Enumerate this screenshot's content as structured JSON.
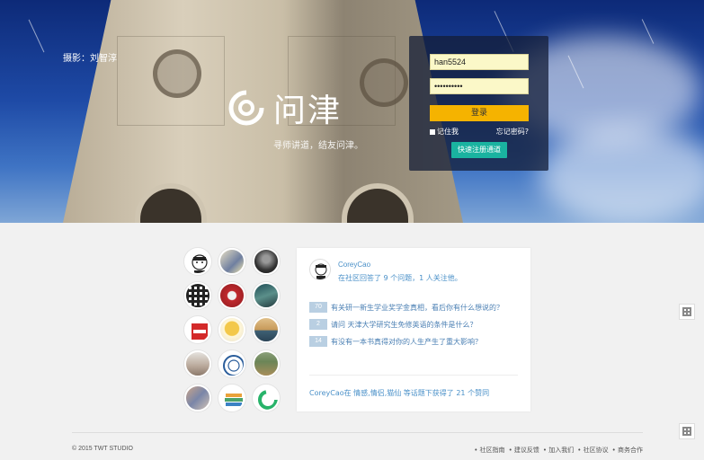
{
  "hero": {
    "photo_credit": "摄影：刘智淳",
    "brand": "问津",
    "slogan": "寻师讲道，结友问津。"
  },
  "login": {
    "username_value": "han5524",
    "password_value": "••••••••••",
    "login_label": "登录",
    "remember_label": "记住我",
    "forgot_label": "忘记密码?",
    "quick_register_label": "快速注册通道"
  },
  "avatars": [
    "cartoon-face",
    "anime-character",
    "dark-portrait",
    "qr-code",
    "red-figure",
    "teal-landscape",
    "wrong-way-sign",
    "yellow-cartoon",
    "sunset-landscape",
    "grey-photo",
    "university-badge",
    "field-photo",
    "crowd-photo",
    "stacked-books",
    "green-logo"
  ],
  "card": {
    "user_name": "CoreyCao",
    "user_stat": "在社区回答了 9 个问题，1 人关注他。",
    "questions": [
      {
        "count": "70",
        "text": "有关研一新生学业奖学金真相，看后你有什么想说的？"
      },
      {
        "count": "2",
        "text": "请问 天津大学研究生免修英语的条件是什么？"
      },
      {
        "count": "14",
        "text": "有没有一本书真得对你的人生产生了重大影响？"
      }
    ],
    "summary": "CoreyCao在 情感,情侣,猫仙 等话题下获得了 21 个赞同"
  },
  "footer": {
    "copyright": "© 2015 TWT STUDIO",
    "links": [
      "• 社区指南",
      "• 建议反馈",
      "• 加入我们",
      "• 社区协议",
      "• 商务合作"
    ]
  },
  "colors": {
    "login_button": "#f5b300",
    "quick_button": "#1ab3a0",
    "link": "#4a90c8",
    "badge": "#b9cfe2"
  }
}
